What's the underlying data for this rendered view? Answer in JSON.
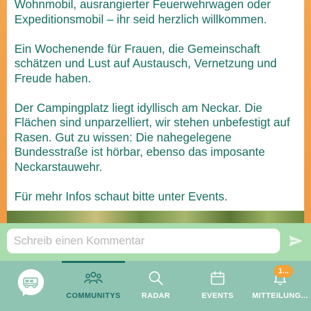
{
  "post": {
    "paragraphs": [
      "Wohnmobil, ausrangierter Feuerwehrwagen oder Expeditionsmobil – ihr seid herzlich willkommen.",
      "Ein Wochenende für Frauen, die Gemeinschaft schätzen und Lust auf Austausch, Vernetzung und Freude haben.",
      "Der Campingplatz liegt idyllisch am Neckar. Die Flächen sind unparzelliert, wir stehen unbefestigt auf Rasen. Gut zu wissen: Die nahegelegene Bundesstraße ist hörbar, ebenso das imposante Neckarstauwehr.",
      "Für mehr Infos schaut bitte unter Events."
    ]
  },
  "comment": {
    "placeholder": "Schreib einen Kommentar",
    "value": "",
    "send_icon": "send-arrow-icon"
  },
  "tabbar": {
    "home_icon": "campervan-icon",
    "tabs": [
      {
        "label": "COMMUNITYS",
        "icon": "people-group-icon",
        "active": true
      },
      {
        "label": "RADAR",
        "icon": "search-icon",
        "active": false
      },
      {
        "label": "EVENTS",
        "icon": "calendar-icon",
        "active": false
      },
      {
        "label": "MITTEILUNG...",
        "icon": "bell-icon",
        "active": false
      }
    ],
    "notification_badge": "1..."
  },
  "colors": {
    "accent": "#176e62",
    "frame_orange": "#f0a14a",
    "comment_bar": "#a9dcae",
    "tabbar": "#8fc3b2",
    "badge": "#f5a236"
  }
}
